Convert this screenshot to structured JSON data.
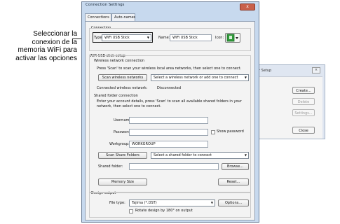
{
  "annotation": {
    "line1": "Seleccionar la",
    "line2": "conexion de la",
    "line3": "memoria WiFi para",
    "line4": "activar las opciones"
  },
  "background_dialog": {
    "title": "r Setup",
    "close_glyph": "×",
    "buttons": [
      {
        "label": "Create...",
        "disabled": false
      },
      {
        "label": "Delete",
        "disabled": true
      },
      {
        "label": "Settings...",
        "disabled": true
      },
      {
        "label": "Close",
        "disabled": false
      }
    ]
  },
  "dialog": {
    "title": "Connection Settings",
    "close_glyph": "x",
    "tabs": [
      "Connections",
      "Auto-names"
    ],
    "connection": {
      "group_label": "Connection",
      "type_label": "Type:",
      "type_value": "WiFi USB Stick",
      "name_label": "Name:",
      "name_value": "WiFi USB Stick",
      "icon_label": "Icon:"
    },
    "wifi_setup": {
      "group_label": "WiFi USB stick setup",
      "wireless": {
        "label": "Wireless network connection",
        "hint": "Press 'Scan' to scan your wireless local area networks, then select one to connect.",
        "scan_button": "Scan wireless networks",
        "network_select": "Select a wireless network or add one to connect",
        "connected_label": "Connected wireless network:",
        "connected_value": "Disconnected"
      },
      "shared": {
        "label": "Shared folder connection",
        "hint_line1": "Enter your account details, press 'Scan' to scan all available shared folders in your",
        "hint_line2": "network, then select one to connect.",
        "username_label": "Username:",
        "username_value": "",
        "password_label": "Password:",
        "password_value": "",
        "show_password_label": "Show password",
        "workgroup_label": "Workgroup:",
        "workgroup_value": "WORKGROUP",
        "scan_button": "Scan Share Folders",
        "folder_select": "Select a shared folder to connect",
        "shared_folder_label": "Shared folder:",
        "shared_folder_value": "",
        "browse_button": "Browse..."
      },
      "memory_button": "Memory Size",
      "reset_button": "Reset..."
    },
    "design_output": {
      "group_label": "Design output",
      "file_type_label": "File type:",
      "file_type_value": "Tajima (*.DST)",
      "options_button": "Options...",
      "rotate_label": "Rotate design by 180° on output",
      "rotate_checked": false
    }
  }
}
